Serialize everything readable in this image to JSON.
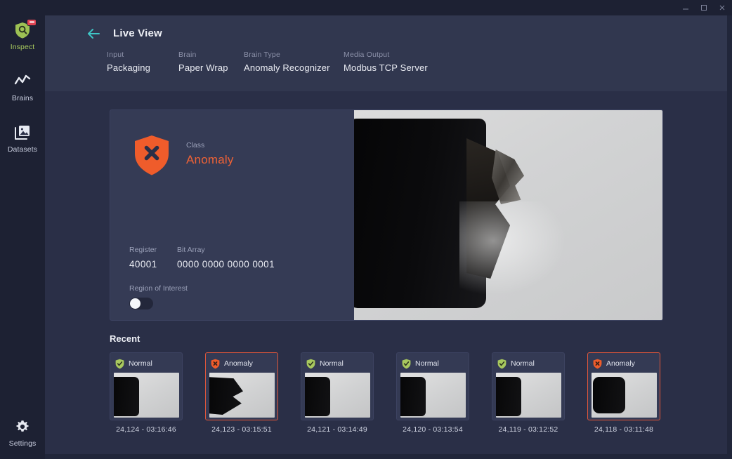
{
  "window": {
    "controls": [
      {
        "name": "minimize",
        "glyph": "minimize-icon"
      },
      {
        "name": "maximize",
        "glyph": "maximize-icon"
      },
      {
        "name": "close",
        "glyph": "close-icon"
      }
    ]
  },
  "sidebar": {
    "items": [
      {
        "label": "Inspect",
        "icon": "shield-search-icon",
        "active": true,
        "badge": true
      },
      {
        "label": "Brains",
        "icon": "line-chart-icon",
        "active": false,
        "badge": false
      },
      {
        "label": "Datasets",
        "icon": "images-stack-icon",
        "active": false,
        "badge": false
      }
    ],
    "settings": {
      "label": "Settings",
      "icon": "gear-icon"
    }
  },
  "header": {
    "back_icon": "arrow-left-icon",
    "title": "Live View",
    "meta": [
      {
        "label": "Input",
        "value": "Packaging"
      },
      {
        "label": "Brain",
        "value": "Paper Wrap"
      },
      {
        "label": "Brain Type",
        "value": "Anomaly Recognizer"
      },
      {
        "label": "Media Output",
        "value": "Modbus TCP Server"
      }
    ]
  },
  "result": {
    "status_icon": "shield-x-icon",
    "class_label": "Class",
    "class_value": "Anomaly",
    "register_label": "Register",
    "register_value": "40001",
    "bit_array_label": "Bit Array",
    "bit_array_value": "0000 0000 0000 0001",
    "roi_label": "Region of Interest",
    "roi_enabled": false
  },
  "recent": {
    "title": "Recent",
    "items": [
      {
        "status": "Normal",
        "icon": "shield-check-icon",
        "id": "24,124",
        "time": "03:16:46",
        "caption": "24,124  -  03:16:46",
        "anomaly": false
      },
      {
        "status": "Anomaly",
        "icon": "shield-x-icon",
        "id": "24,123",
        "time": "03:15:51",
        "caption": "24,123  -  03:15:51",
        "anomaly": true
      },
      {
        "status": "Normal",
        "icon": "shield-check-icon",
        "id": "24,121",
        "time": "03:14:49",
        "caption": "24,121  -  03:14:49",
        "anomaly": false
      },
      {
        "status": "Normal",
        "icon": "shield-check-icon",
        "id": "24,120",
        "time": "03:13:54",
        "caption": "24,120  -  03:13:54",
        "anomaly": false
      },
      {
        "status": "Normal",
        "icon": "shield-check-icon",
        "id": "24,119",
        "time": "03:12:52",
        "caption": "24,119  -  03:12:52",
        "anomaly": false
      },
      {
        "status": "Anomaly",
        "icon": "shield-x-icon",
        "id": "24,118",
        "time": "03:11:48",
        "caption": "24,118  -  03:11:48",
        "anomaly": true
      }
    ]
  },
  "colors": {
    "app_bg": "#1d2133",
    "panel_bg": "#2a2f47",
    "header_bg": "#31374f",
    "card_bg": "#353b55",
    "accent_teal": "#3fc6c6",
    "anomaly_orange": "#ef6236",
    "normal_green": "#a8c95e",
    "badge_red": "#e04352",
    "text_primary": "#eaecf3",
    "text_muted": "#9aa0b8"
  }
}
